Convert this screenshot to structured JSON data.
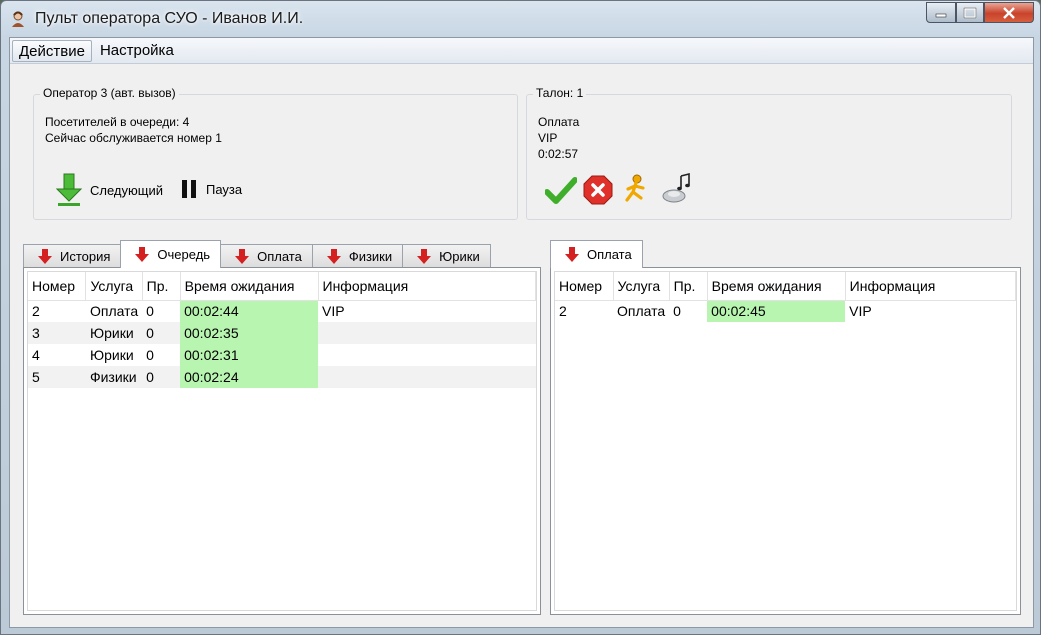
{
  "window": {
    "title": "Пульт оператора СУО - Иванов И.И."
  },
  "menu": {
    "items": [
      "Действие",
      "Настройка"
    ]
  },
  "operator_panel": {
    "title": "Оператор 3 (авт. вызов)",
    "queue_line": "Посетителей в очереди: 4",
    "serving_line": "Сейчас обслуживается номер 1",
    "next_label": "Следующий",
    "pause_label": "Пауза"
  },
  "ticket_panel": {
    "title": "Талон: 1",
    "service": "Оплата",
    "info": "VIP",
    "time": "0:02:57",
    "actions": [
      "check-icon",
      "cancel-icon",
      "redirect-icon",
      "sound-icon"
    ]
  },
  "left_tabs": [
    "История",
    "Очередь",
    "Оплата",
    "Физики",
    "Юрики"
  ],
  "left_selected_tab": "Очередь",
  "right_tabs": [
    "Оплата"
  ],
  "columns": [
    "Номер",
    "Услуга",
    "Пр.",
    "Время ожидания",
    "Информация"
  ],
  "left_rows": [
    {
      "num": "2",
      "service": "Оплата",
      "pr": "0",
      "wait": "00:02:44",
      "info": "VIP"
    },
    {
      "num": "3",
      "service": "Юрики",
      "pr": "0",
      "wait": "00:02:35",
      "info": ""
    },
    {
      "num": "4",
      "service": "Юрики",
      "pr": "0",
      "wait": "00:02:31",
      "info": ""
    },
    {
      "num": "5",
      "service": "Физики",
      "pr": "0",
      "wait": "00:02:24",
      "info": ""
    }
  ],
  "right_rows": [
    {
      "num": "2",
      "service": "Оплата",
      "pr": "0",
      "wait": "00:02:45",
      "info": "VIP"
    }
  ],
  "colors": {
    "wait_highlight": "#b8f5b0",
    "tab_arrow": "#d42020",
    "next_arrow": "#3aa52a"
  }
}
